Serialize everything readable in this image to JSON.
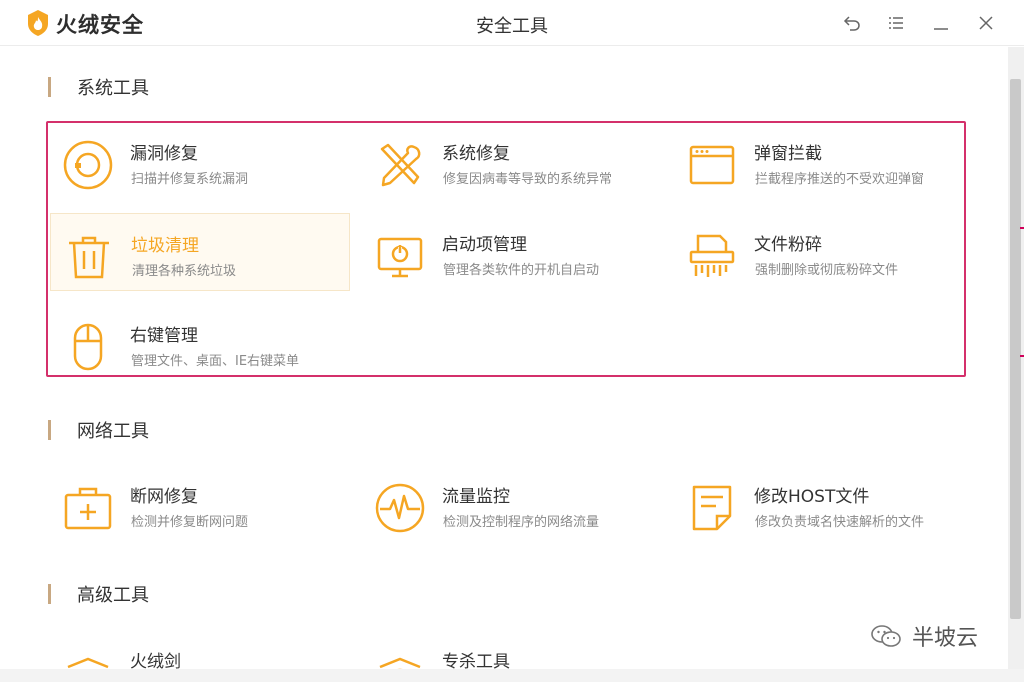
{
  "app": {
    "name": "火绒安全",
    "window_title": "安全工具"
  },
  "titlebar_buttons": {
    "back": "back-icon",
    "menu": "menu-icon",
    "minimize": "minimize-icon",
    "close": "close-icon"
  },
  "colors": {
    "accent": "#f5a623",
    "highlight_bg": "#fffaf1",
    "annotation_box": "#d4306b",
    "section_bar": "#c8a882"
  },
  "sections": [
    {
      "label": "系统工具",
      "items": [
        {
          "title": "漏洞修复",
          "desc": "扫描并修复系统漏洞",
          "icon": "patch-icon"
        },
        {
          "title": "系统修复",
          "desc": "修复因病毒等导致的系统异常",
          "icon": "repair-tools-icon"
        },
        {
          "title": "弹窗拦截",
          "desc": "拦截程序推送的不受欢迎弹窗",
          "icon": "popup-window-icon"
        },
        {
          "title": "垃圾清理",
          "desc": "清理各种系统垃圾",
          "icon": "trash-icon",
          "highlighted": true
        },
        {
          "title": "启动项管理",
          "desc": "管理各类软件的开机自启动",
          "icon": "startup-monitor-icon"
        },
        {
          "title": "文件粉碎",
          "desc": "强制删除或彻底粉碎文件",
          "icon": "shredder-icon"
        },
        {
          "title": "右键管理",
          "desc": "管理文件、桌面、IE右键菜单",
          "icon": "mouse-icon"
        }
      ]
    },
    {
      "label": "网络工具",
      "items": [
        {
          "title": "断网修复",
          "desc": "检测并修复断网问题",
          "icon": "first-aid-icon"
        },
        {
          "title": "流量监控",
          "desc": "检测及控制程序的网络流量",
          "icon": "traffic-pulse-icon"
        },
        {
          "title": "修改HOST文件",
          "desc": "修改负责域名快速解析的文件",
          "icon": "document-icon"
        }
      ]
    },
    {
      "label": "高级工具",
      "items": [
        {
          "title": "火绒剑",
          "icon": "sword-icon"
        },
        {
          "title": "专杀工具",
          "icon": "shield-icon"
        }
      ]
    }
  ],
  "watermark": {
    "text": "半坡云"
  }
}
